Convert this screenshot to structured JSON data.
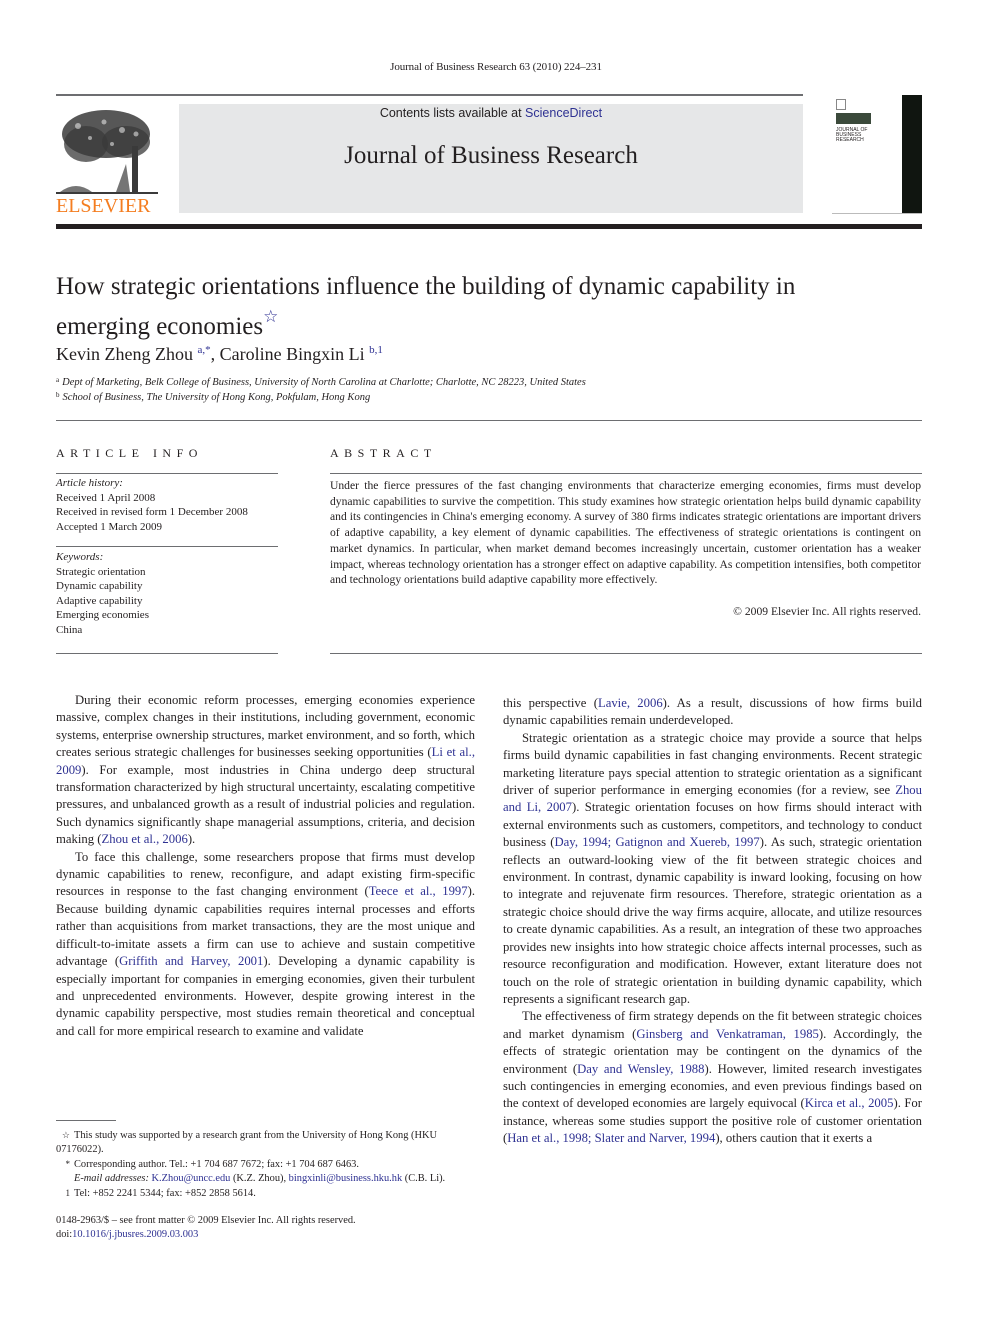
{
  "header": {
    "running_head": "Journal of Business Research 63 (2010) 224–231",
    "contents_prefix": "Contents lists available at ",
    "contents_link": "ScienceDirect",
    "journal_title": "Journal of Business Research",
    "publisher_logo_text": "ELSEVIER",
    "cover_title": "Journal of Business Research",
    "colors": {
      "link": "#2e3192",
      "elsevier_orange": "#f47d20",
      "banner_bg": "#e6e7e8"
    }
  },
  "article": {
    "title": "How strategic orientations influence the building of dynamic capability in emerging economies",
    "title_note_mark": "☆",
    "authors": [
      {
        "name": "Kevin Zheng Zhou",
        "marks": "a,*"
      },
      {
        "name": "Caroline Bingxin Li",
        "marks": "b,1"
      }
    ],
    "author_separator": ", ",
    "affiliations": [
      {
        "mark": "a",
        "text": "Dept of Marketing, Belk College of Business, University of North Carolina at Charlotte; Charlotte, NC 28223, United States"
      },
      {
        "mark": "b",
        "text": "School of Business, The University of Hong Kong, Pokfulam, Hong Kong"
      }
    ]
  },
  "article_info": {
    "heading": "ARTICLE INFO",
    "history_label": "Article history:",
    "history": [
      "Received 1 April 2008",
      "Received in revised form 1 December 2008",
      "Accepted 1 March 2009"
    ],
    "keywords_label": "Keywords:",
    "keywords": [
      "Strategic orientation",
      "Dynamic capability",
      "Adaptive capability",
      "Emerging economies",
      "China"
    ]
  },
  "abstract": {
    "heading": "ABSTRACT",
    "text": "Under the fierce pressures of the fast changing environments that characterize emerging economies, firms must develop dynamic capabilities to survive the competition. This study examines how strategic orientation helps build dynamic capability and its contingencies in China's emerging economy. A survey of 380 firms indicates strategic orientations are important drivers of adaptive capability, a key element of dynamic capabilities. The effectiveness of strategic orientations is contingent on market dynamics. In particular, when market demand becomes increasingly uncertain, customer orientation has a weaker impact, whereas technology orientation has a stronger effect on adaptive capability. As competition intensifies, both competitor and technology orientations build adaptive capability more effectively.",
    "copyright": "© 2009 Elsevier Inc. All rights reserved."
  },
  "body": {
    "left": [
      {
        "indent": true,
        "segments": [
          {
            "t": "During their economic reform processes, emerging economies experience massive, complex changes in their institutions, including government, economic systems, enterprise ownership structures, market environment, and so forth, which creates serious strategic challenges for businesses seeking opportunities ("
          },
          {
            "t": "Li et al., 2009",
            "link": true
          },
          {
            "t": "). For example, most industries in China undergo deep structural transformation characterized by high structural uncertainty, escalating competitive pressures, and unbalanced growth as a result of industrial policies and regulation. Such dynamics significantly shape managerial assumptions, criteria, and decision making ("
          },
          {
            "t": "Zhou et al., 2006",
            "link": true
          },
          {
            "t": ")."
          }
        ]
      },
      {
        "indent": true,
        "segments": [
          {
            "t": "To face this challenge, some researchers propose that firms must develop dynamic capabilities to renew, reconfigure, and adapt existing firm-specific resources in response to the fast changing environment ("
          },
          {
            "t": "Teece et al., 1997",
            "link": true
          },
          {
            "t": "). Because building dynamic capabilities requires internal processes and efforts rather than acquisitions from market transactions, they are the most unique and difficult-to-imitate assets a firm can use to achieve and sustain competitive advantage ("
          },
          {
            "t": "Griffith and Harvey, 2001",
            "link": true
          },
          {
            "t": "). Developing a dynamic capability is especially important for companies in emerging economies, given their turbulent and unprecedented environments. However, despite growing interest in the dynamic capability perspective, most studies remain theoretical and conceptual and call for more empirical research to examine and validate"
          }
        ]
      }
    ],
    "right": [
      {
        "indent": false,
        "segments": [
          {
            "t": "this perspective ("
          },
          {
            "t": "Lavie, 2006",
            "link": true
          },
          {
            "t": "). As a result, discussions of how firms build dynamic capabilities remain underdeveloped."
          }
        ]
      },
      {
        "indent": true,
        "segments": [
          {
            "t": "Strategic orientation as a strategic choice may provide a source that helps firms build dynamic capabilities in fast changing environments. Recent strategic marketing literature pays special attention to strategic orientation as a significant driver of superior performance in emerging economies (for a review, see "
          },
          {
            "t": "Zhou and Li, 2007",
            "link": true
          },
          {
            "t": "). Strategic orientation focuses on how firms should interact with external environments such as customers, competitors, and technology to conduct business ("
          },
          {
            "t": "Day, 1994; Gatignon and Xuereb, 1997",
            "link": true
          },
          {
            "t": "). As such, strategic orientation reflects an outward-looking view of the fit between strategic choices and environment. In contrast, dynamic capability is inward looking, focusing on how to integrate and rejuvenate firm resources. Therefore, strategic orientation as a strategic choice should drive the way firms acquire, allocate, and utilize resources to create dynamic capabilities. As a result, an integration of these two approaches provides new insights into how strategic choice affects internal processes, such as resource reconfiguration and modification. However, extant literature does not touch on the role of strategic orientation in building dynamic capability, which represents a significant research gap."
          }
        ]
      },
      {
        "indent": true,
        "segments": [
          {
            "t": "The effectiveness of firm strategy depends on the fit between strategic choices and market dynamism ("
          },
          {
            "t": "Ginsberg and Venkatraman, 1985",
            "link": true
          },
          {
            "t": "). Accordingly, the effects of strategic orientation may be contingent on the dynamics of the environment ("
          },
          {
            "t": "Day and Wensley, 1988",
            "link": true
          },
          {
            "t": "). However, limited research investigates such contingencies in emerging economies, and even previous findings based on the context of developed economies are largely equivocal ("
          },
          {
            "t": "Kirca et al., 2005",
            "link": true
          },
          {
            "t": "). For instance, whereas some studies support the positive role of customer orientation ("
          },
          {
            "t": "Han et al., 1998; Slater and Narver, 1994",
            "link": true
          },
          {
            "t": "), others caution that it exerts a"
          }
        ]
      }
    ]
  },
  "footnotes": {
    "star_mark": "☆",
    "star_text": "This study was supported by a research grant from the University of Hong Kong (HKU 07176022).",
    "corr_mark": "*",
    "corr_text": "Corresponding author. Tel.: +1 704 687 7672; fax: +1 704 687 6463.",
    "email_label": "E-mail addresses:",
    "email1": "K.Zhou@uncc.edu",
    "email1_owner": " (K.Z. Zhou), ",
    "email2": "bingxinli@business.hku.hk",
    "email2_owner": " (C.B. Li).",
    "one_mark": "1",
    "one_text": "Tel: +852 2241 5344; fax: +852 2858 5614."
  },
  "front_matter": {
    "issn_line": "0148-2963/$ – see front matter © 2009 Elsevier Inc. All rights reserved.",
    "doi_prefix": "doi:",
    "doi": "10.1016/j.jbusres.2009.03.003"
  }
}
